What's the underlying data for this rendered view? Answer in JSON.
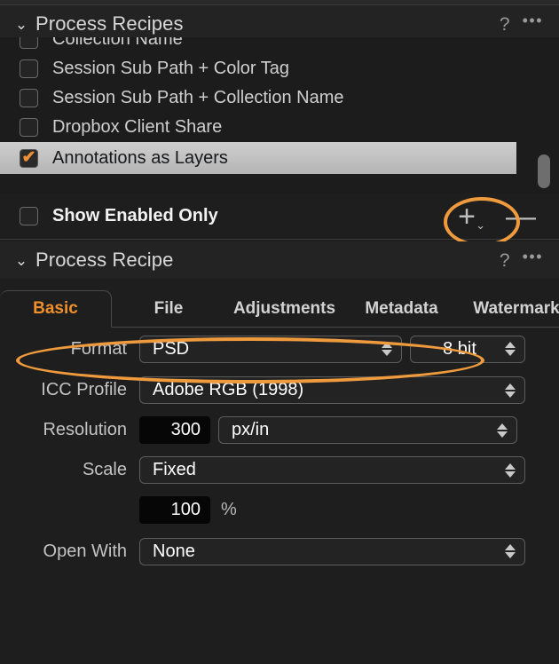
{
  "panels": {
    "recipes": {
      "title": "Process Recipes",
      "help_icon": "?",
      "more_icon": "•••",
      "disclosure_icon": "⌄",
      "items": [
        {
          "label": "Collection Name",
          "checked": false
        },
        {
          "label": "Session Sub Path + Color Tag",
          "checked": false
        },
        {
          "label": "Session Sub Path + Collection Name",
          "checked": false
        },
        {
          "label": "Dropbox Client Share",
          "checked": false
        },
        {
          "label": "Annotations as Layers",
          "checked": true,
          "selected": true
        }
      ],
      "filter": {
        "label": "Show Enabled Only",
        "checked": false,
        "add_icon": "+",
        "add_chevron": "⌄",
        "remove_icon": "—"
      }
    },
    "recipe": {
      "title": "Process Recipe",
      "help_icon": "?",
      "more_icon": "•••",
      "disclosure_icon": "⌄",
      "tabs": [
        {
          "label": "Basic",
          "active": true
        },
        {
          "label": "File",
          "active": false
        },
        {
          "label": "Adjustments",
          "active": false
        },
        {
          "label": "Metadata",
          "active": false
        },
        {
          "label": "Watermark",
          "active": false
        }
      ],
      "fields": {
        "format_label": "Format",
        "format_value": "PSD",
        "bitdepth_value": "8 bit",
        "icc_label": "ICC Profile",
        "icc_value": "Adobe RGB (1998)",
        "resolution_label": "Resolution",
        "resolution_value": "300",
        "resolution_unit": "px/in",
        "scale_label": "Scale",
        "scale_value": "Fixed",
        "scale_percent_value": "100",
        "scale_percent_unit": "%",
        "openwith_label": "Open With",
        "openwith_value": "None"
      }
    }
  },
  "colors": {
    "accent_orange": "#f0902a",
    "highlight_orange": "#ef9b3d",
    "panel_bg": "#1e1e1e",
    "list_bg": "#1c1c1c",
    "header_bg": "#232323",
    "selected_row": "#c4c4c4"
  }
}
